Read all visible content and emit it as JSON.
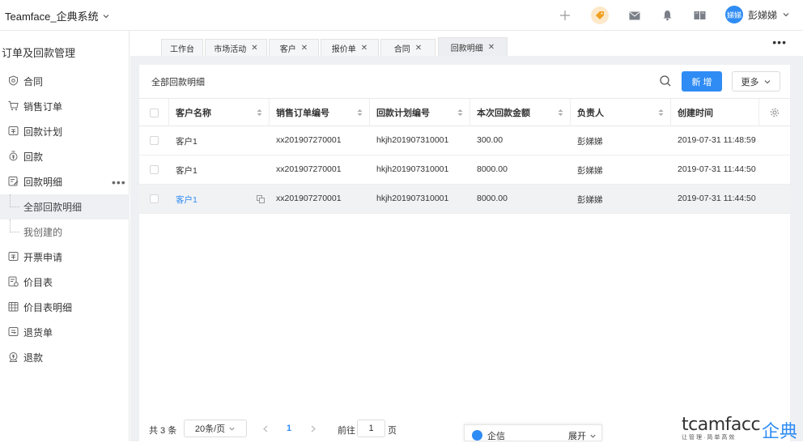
{
  "app": {
    "title": "Teamface_企典系统",
    "user_initials": "娣娣",
    "user_name": "彭娣娣"
  },
  "colors": {
    "accent": "#2f8cf4"
  },
  "sidebar": {
    "title": "订单及回款管理",
    "items": [
      {
        "label": "合同",
        "icon": "contract-icon"
      },
      {
        "label": "销售订单",
        "icon": "cart-icon"
      },
      {
        "label": "回款计划",
        "icon": "payment-plan-icon"
      },
      {
        "label": "回款",
        "icon": "payment-icon"
      },
      {
        "label": "回款明细",
        "icon": "payment-detail-icon"
      },
      {
        "label": "全部回款明细",
        "icon": ""
      },
      {
        "label": "我创建的",
        "icon": ""
      },
      {
        "label": "开票申请",
        "icon": "invoice-icon"
      },
      {
        "label": "价目表",
        "icon": "price-list-icon"
      },
      {
        "label": "价目表明细",
        "icon": "price-detail-icon"
      },
      {
        "label": "退货单",
        "icon": "return-icon"
      },
      {
        "label": "退款",
        "icon": "refund-icon"
      }
    ]
  },
  "tabs": [
    {
      "label": "工作台"
    },
    {
      "label": "市场活动"
    },
    {
      "label": "客户"
    },
    {
      "label": "报价单"
    },
    {
      "label": "合同"
    },
    {
      "label": "回款明细"
    }
  ],
  "panel": {
    "title": "全部回款明细",
    "new_label": "新 增",
    "more_label": "更多"
  },
  "table": {
    "columns": [
      "客户名称",
      "销售订单编号",
      "回款计划编号",
      "本次回款金额",
      "负责人",
      "创建时间"
    ],
    "rows": [
      [
        "客户1",
        "xx201907270001",
        "hkjh201907310001",
        "300.00",
        "彭娣娣",
        "2019-07-31 11:48:59"
      ],
      [
        "客户1",
        "xx201907270001",
        "hkjh201907310001",
        "8000.00",
        "彭娣娣",
        "2019-07-31 11:44:50"
      ],
      [
        "客户1",
        "xx201907270001",
        "hkjh201907310001",
        "8000.00",
        "彭娣娣",
        "2019-07-31 11:44:50"
      ]
    ]
  },
  "pager": {
    "total": "共 3 条",
    "page_size": "20条/页",
    "current": "1",
    "goto": "前往",
    "goto_value": "1",
    "page_unit": "页"
  },
  "chat": {
    "name": "企信",
    "expand": "展开"
  },
  "watermark": {
    "en": "tcamfacc",
    "cn": "企典",
    "sub": "让管理·简单高效"
  }
}
